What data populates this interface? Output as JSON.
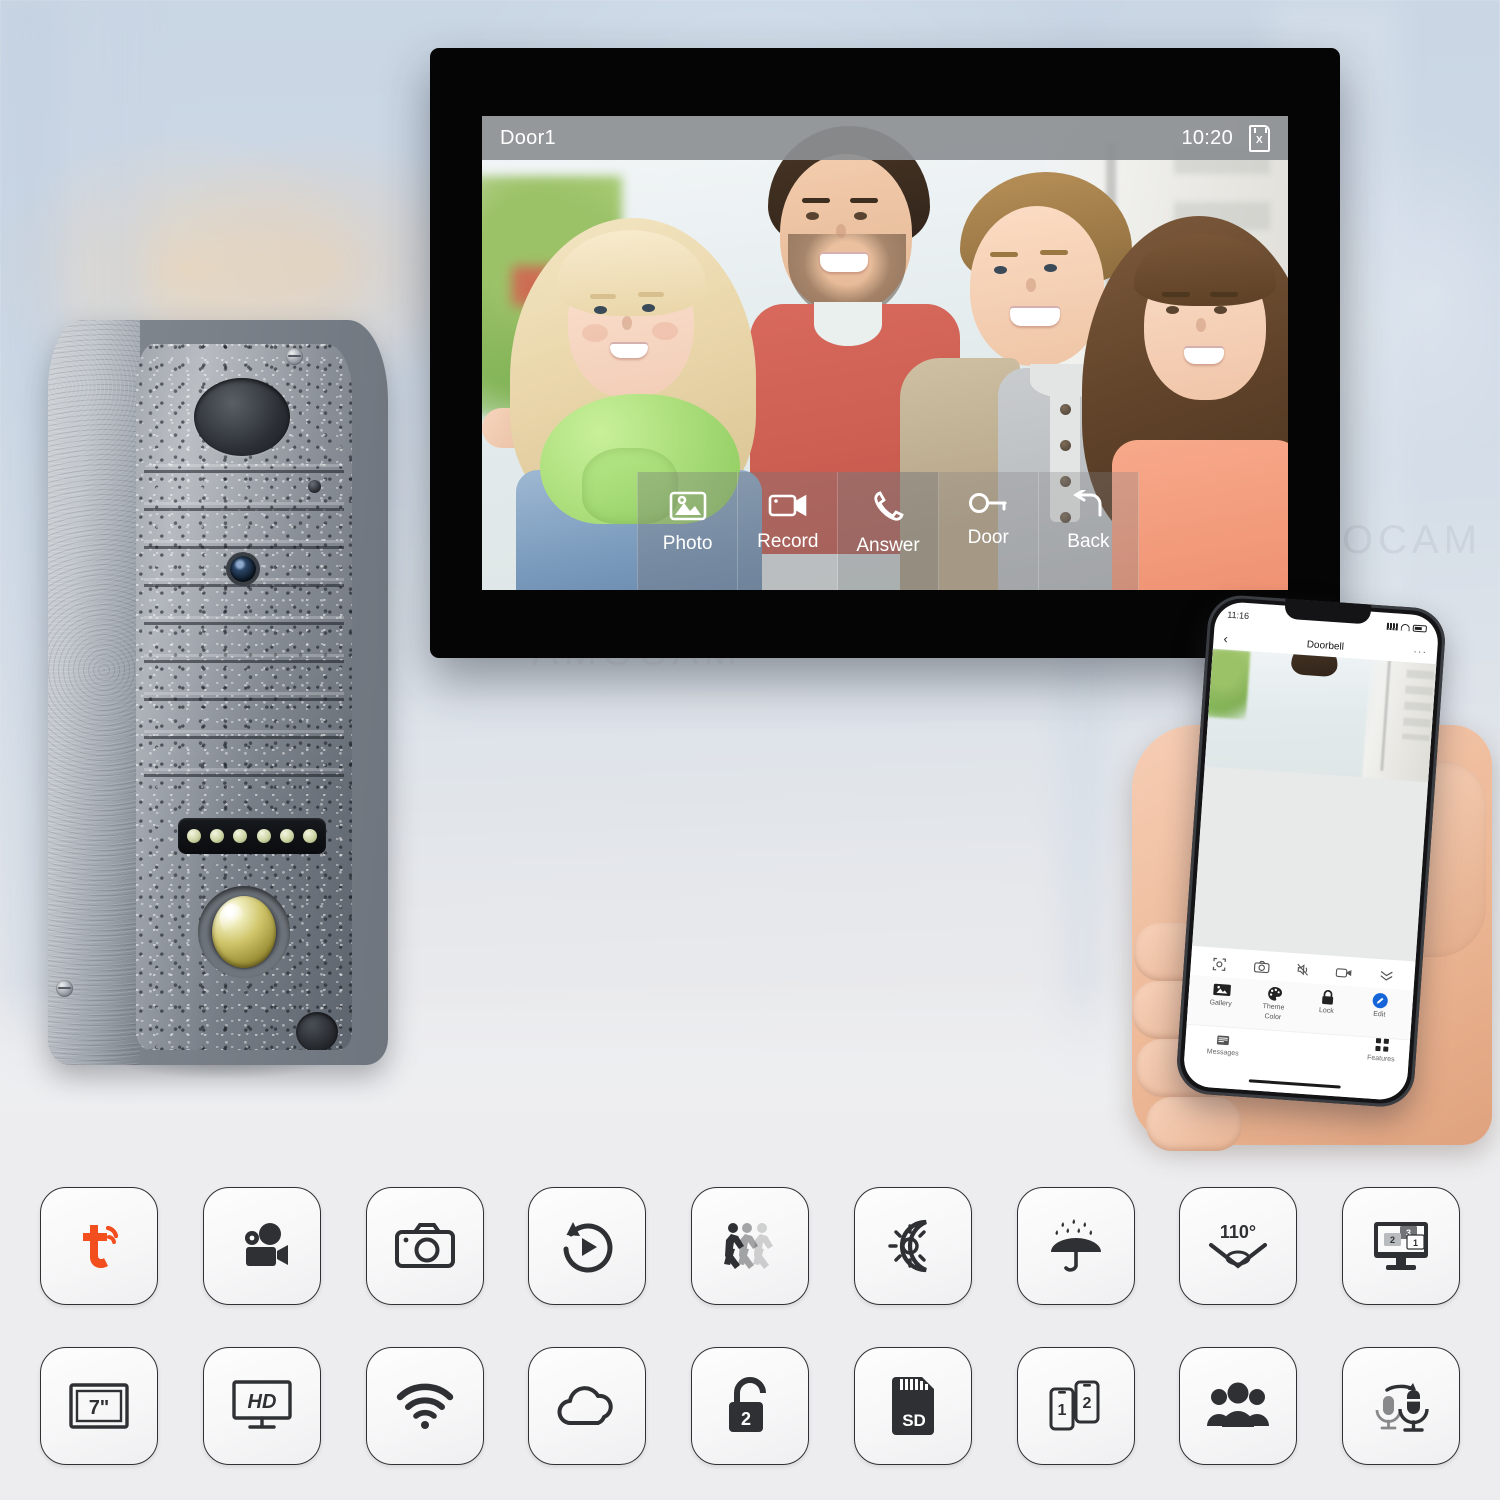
{
  "brand": {
    "watermark": "AMOCAM"
  },
  "monitor": {
    "status_bar": {
      "channel_label": "Door1",
      "time": "10:20",
      "sd_icon": "sd-card-icon",
      "sd_icon_text": "X"
    },
    "controls": [
      {
        "label": "Photo",
        "icon": "photo-icon"
      },
      {
        "label": "Record",
        "icon": "video-record-icon"
      },
      {
        "label": "Answer",
        "icon": "phone-handset-icon"
      },
      {
        "label": "Door",
        "icon": "key-unlock-icon"
      },
      {
        "label": "Back",
        "icon": "back-arrow-icon"
      }
    ]
  },
  "phone": {
    "status": {
      "time": "11:16"
    },
    "header": {
      "title": "Doorbell",
      "back": "‹",
      "more": "···"
    },
    "toolbar_top": [
      {
        "icon": "fullscreen-icon"
      },
      {
        "icon": "snapshot-camera-icon"
      },
      {
        "icon": "mute-speaker-icon"
      },
      {
        "icon": "video-record-icon"
      },
      {
        "icon": "collapse-chevrons-icon"
      }
    ],
    "toolbar_main": [
      {
        "label": "Gallery",
        "icon": "gallery-icon"
      },
      {
        "label": "Theme\nColor",
        "icon": "theme-palette-icon",
        "line1": "Theme",
        "line2": "Color"
      },
      {
        "label": "Lock",
        "icon": "lock-icon"
      },
      {
        "label": "Edit",
        "icon": "edit-pencil-icon",
        "accent": "#1565d8"
      }
    ],
    "bottom_nav": [
      {
        "label": "Messages",
        "icon": "messages-icon"
      },
      {
        "label": "Features",
        "icon": "features-grid-icon"
      }
    ]
  },
  "features": {
    "row1": [
      {
        "name": "tuya-smart-app-icon",
        "label": "Tuya Smart App",
        "color": "#f24e1e"
      },
      {
        "name": "video-recording-icon",
        "label": "Video Recording"
      },
      {
        "name": "snapshot-camera-icon",
        "label": "Snapshot"
      },
      {
        "name": "playback-icon",
        "label": "Playback"
      },
      {
        "name": "motion-detection-icon",
        "label": "Motion Detection"
      },
      {
        "name": "day-night-vision-icon",
        "label": "Day / Night Vision"
      },
      {
        "name": "waterproof-icon",
        "label": "Waterproof"
      },
      {
        "name": "wide-angle-icon",
        "label": "Wide Angle",
        "text": "110°"
      },
      {
        "name": "multi-monitor-icon",
        "label": "Multi Monitor",
        "badge1": "1",
        "badge2": "2",
        "badge3": "3"
      }
    ],
    "row2": [
      {
        "name": "screen-size-icon",
        "label": "7 inch Screen",
        "text": "7\""
      },
      {
        "name": "hd-resolution-icon",
        "label": "HD Resolution",
        "text": "HD"
      },
      {
        "name": "wifi-icon",
        "label": "WiFi"
      },
      {
        "name": "cloud-storage-icon",
        "label": "Cloud Storage"
      },
      {
        "name": "two-lock-icon",
        "label": "Two Lock Control",
        "text": "2"
      },
      {
        "name": "sd-card-icon",
        "label": "SD Card Storage",
        "text": "SD"
      },
      {
        "name": "two-phones-icon",
        "label": "Two Phones",
        "text1": "1",
        "text2": "2"
      },
      {
        "name": "multi-user-icon",
        "label": "Multi User Sharing"
      },
      {
        "name": "two-way-audio-icon",
        "label": "Two Way Audio"
      }
    ]
  }
}
